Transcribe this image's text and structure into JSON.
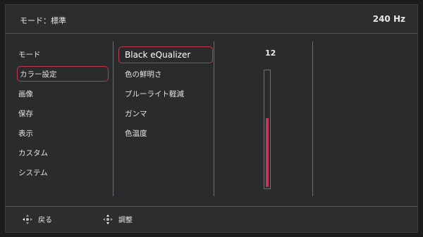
{
  "header": {
    "mode": "モード：標準",
    "refresh": "240 Hz"
  },
  "menu": {
    "items": [
      "モード",
      "カラー設定",
      "画像",
      "保存",
      "表示",
      "カスタム",
      "システム"
    ],
    "selected_index": 1
  },
  "submenu": {
    "items": [
      "Black eQualizer",
      "色の鮮明さ",
      "ブルーライト軽減",
      "ガンマ",
      "色温度"
    ],
    "selected_index": 0
  },
  "value_panel": {
    "value": "12",
    "level_fraction": 0.6,
    "fill_color": "#c0395a"
  },
  "footer": {
    "back_label": "戻る",
    "adjust_label": "調整"
  },
  "colors": {
    "accent": "#c0394f",
    "background": "#2a2b2d"
  }
}
